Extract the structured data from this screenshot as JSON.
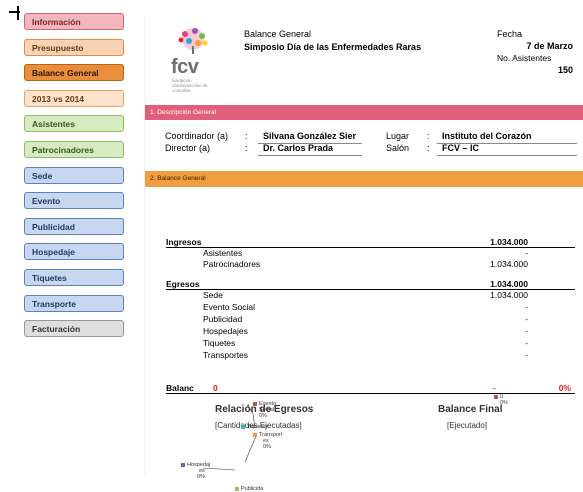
{
  "nav": {
    "items": [
      {
        "label": "Información",
        "style": "red"
      },
      {
        "label": "Presupuesto",
        "style": "orange"
      },
      {
        "label": "Balance General",
        "style": "orange-act"
      },
      {
        "label": "2013 vs 2014",
        "style": "orange-lt"
      },
      {
        "label": "Asistentes",
        "style": "green"
      },
      {
        "label": "Patrocinadores",
        "style": "green"
      },
      {
        "label": "Sede",
        "style": "blue"
      },
      {
        "label": "Evento",
        "style": "blue"
      },
      {
        "label": "Publicidad",
        "style": "blue"
      },
      {
        "label": "Hospedaje",
        "style": "blue"
      },
      {
        "label": "Tiquetes",
        "style": "blue"
      },
      {
        "label": "Transporte",
        "style": "blue"
      },
      {
        "label": "Facturación",
        "style": "gray"
      }
    ]
  },
  "header": {
    "logo_text": "fcv",
    "logo_sub": [
      "fundación",
      "cardiovascular de",
      "colombia"
    ],
    "title": "Balance General",
    "event": "Simposio Día de las Enfermedades Raras",
    "fecha_label": "Fecha",
    "fecha_value": "7 de Marzo",
    "asistentes_label": "No. Asistentes",
    "asistentes_value": "150"
  },
  "section1": {
    "title": "1. Descripción  General",
    "coordinador_label": "Coordinador (a)",
    "coordinador_value": "Silvana González Sier",
    "director_label": "Director (a)",
    "director_value": "Dr. Carlos Prada",
    "lugar_label": "Lugar",
    "lugar_value": "Instituto del Corazón",
    "salon_label": "Salón",
    "salon_value": "FCV – IC",
    "colon": ":"
  },
  "section2": {
    "title": "2. Balance General",
    "ingresos": {
      "label": "Ingresos",
      "total": "1.034.000",
      "rows": [
        {
          "label": "Asistentes",
          "value": "-"
        },
        {
          "label": "Patrocinadores",
          "value": "1.034.000"
        }
      ]
    },
    "egresos": {
      "label": "Egresos",
      "total": "1.034.000",
      "rows": [
        {
          "label": "Sede",
          "value": "1.034.000"
        },
        {
          "label": "Evento Social",
          "value": "-"
        },
        {
          "label": "Publicidad",
          "value": "-"
        },
        {
          "label": "Hospedajes",
          "value": "-"
        },
        {
          "label": "Tiquetes",
          "value": "-"
        },
        {
          "label": "Transportes",
          "value": "-"
        }
      ]
    },
    "balance": {
      "label": "Balanc",
      "value_a": "0",
      "value_b": "-",
      "value_c": "0%"
    }
  },
  "charts": {
    "egresos": {
      "title": "Relación de Egresos",
      "subtitle": "[Cantidades Ejecutadas]",
      "legend": [
        {
          "label": "Evento",
          "label2": "Social",
          "pct": "0%",
          "color": "#c0504d"
        },
        {
          "label": "Tiquete",
          "label2": "s",
          "pct": "",
          "color": "#4bacc6"
        },
        {
          "label": "Transport",
          "label2": "es",
          "pct": "0%",
          "color": "#f79646"
        },
        {
          "label": "Hospedaj",
          "label2": "es",
          "pct": "0%",
          "color": "#8064a2"
        },
        {
          "label": "Publicida",
          "label2": "",
          "pct": "",
          "color": "#9bbb59"
        }
      ]
    },
    "final": {
      "title": "Balance Final",
      "subtitle": "[Ejecutado]",
      "legend": [
        {
          "label": "0",
          "pct": "0%",
          "color": "#c0504d"
        }
      ]
    }
  }
}
